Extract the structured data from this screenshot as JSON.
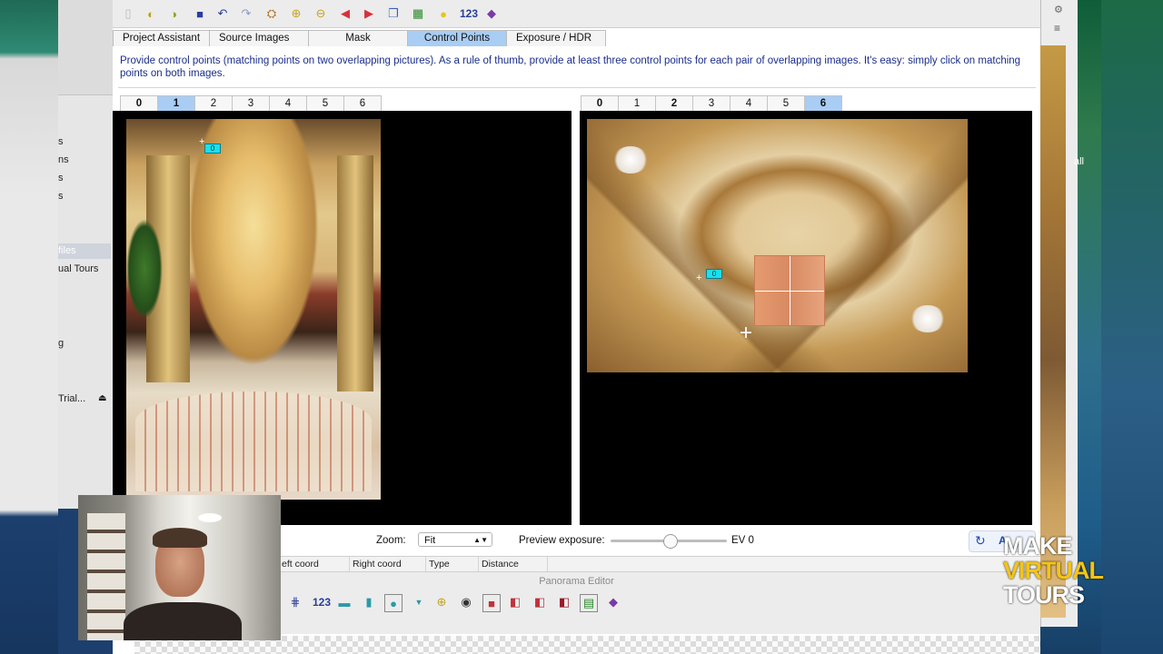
{
  "finder": {
    "items": [
      "s",
      "ns",
      "s",
      "s",
      "files",
      "ual Tours",
      "g",
      "Trial..."
    ],
    "eject": "⏏"
  },
  "behind_right": {
    "text": "all"
  },
  "toolbar": {
    "icons": [
      "new-icon",
      "open-icon",
      "open-recent-icon",
      "save-icon",
      "undo-icon",
      "redo-icon",
      "optimize-icon",
      "zoom-in-icon",
      "zoom-out-icon",
      "previous-image-icon",
      "next-image-icon",
      "overview-icon",
      "table-icon",
      "tip-icon",
      "numbers-icon",
      "assistant-icon"
    ],
    "numbers_label": "123"
  },
  "tabs": [
    {
      "label": "Project Assistant",
      "active": false
    },
    {
      "label": "Source Images",
      "active": false
    },
    {
      "label": "Mask",
      "active": false
    },
    {
      "label": "Control Points",
      "active": true
    },
    {
      "label": "Exposure / HDR",
      "active": false
    }
  ],
  "description": "Provide control points (matching points on two overlapping pictures). As a rule of thumb, provide at least three control points for each pair of overlapping images. It's easy: simply click on matching points on both images.",
  "left_images": [
    {
      "label": "0",
      "bold": true
    },
    {
      "label": "1",
      "active": true
    },
    {
      "label": "2"
    },
    {
      "label": "3"
    },
    {
      "label": "4"
    },
    {
      "label": "5"
    },
    {
      "label": "6"
    }
  ],
  "right_images": [
    {
      "label": "0",
      "bold": true
    },
    {
      "label": "1"
    },
    {
      "label": "2",
      "bold": true
    },
    {
      "label": "3"
    },
    {
      "label": "4"
    },
    {
      "label": "5"
    },
    {
      "label": "6",
      "active": true
    }
  ],
  "control_point_label": "0",
  "zoom": {
    "label": "Zoom:",
    "value": "Fit"
  },
  "preview_exposure": {
    "label": "Preview exposure:",
    "value": 0,
    "unit_label": "EV 0"
  },
  "reset_label": "A",
  "columns": [
    "eft coord",
    "Right coord",
    "Type",
    "Distance"
  ],
  "panorama_editor": {
    "title": "Panorama Editor",
    "numbers_label": "123",
    "icons": [
      "align-icon",
      "numbers-icon",
      "preview-icon",
      "cylinder-icon",
      "globe-icon",
      "dropdown-icon",
      "zoom-icon",
      "eye-icon",
      "layout-icon",
      "mask-a-icon",
      "mask-b-icon",
      "mask-c-icon",
      "grid-icon",
      "assistant-icon"
    ]
  },
  "logo": {
    "line1": "MAKE",
    "line2": "VIRTUAL",
    "line3": "TOURS"
  },
  "colors": {
    "accent_tab": "#a9cdf3",
    "control_point": "#19e0f0",
    "description_text": "#1a2e8a",
    "logo_yellow": "#f5c414"
  }
}
